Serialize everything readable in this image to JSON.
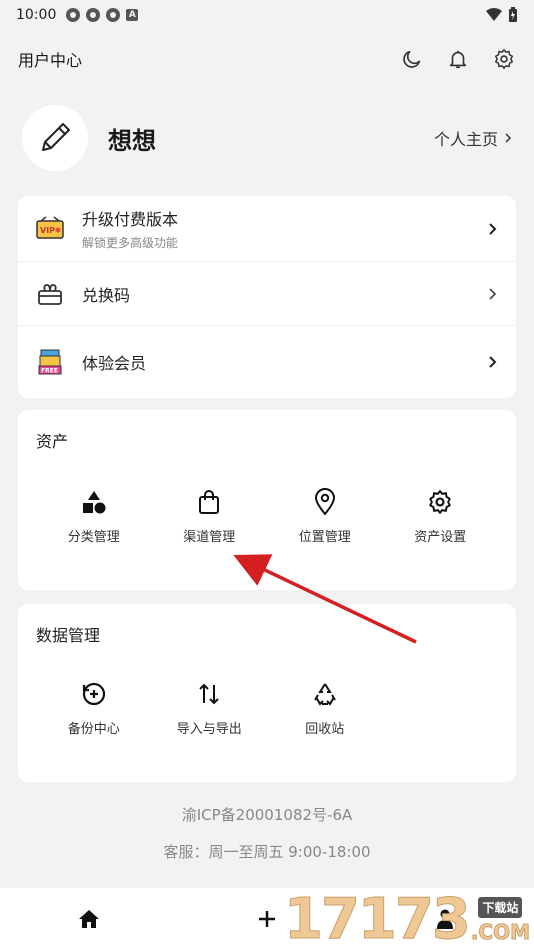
{
  "status_bar": {
    "time": "10:00",
    "a_label": "A"
  },
  "header": {
    "title": "用户中心"
  },
  "profile": {
    "name": "想想",
    "home_link": "个人主页"
  },
  "menu": [
    {
      "label": "升级付费版本",
      "sub": "解锁更多高级功能"
    },
    {
      "label": "兑换码"
    },
    {
      "label": "体验会员"
    }
  ],
  "assets": {
    "title": "资产",
    "items": [
      {
        "label": "分类管理",
        "icon": "shapes-icon"
      },
      {
        "label": "渠道管理",
        "icon": "shopping-bag-icon"
      },
      {
        "label": "位置管理",
        "icon": "location-pin-icon"
      },
      {
        "label": "资产设置",
        "icon": "gear-icon"
      }
    ]
  },
  "data_management": {
    "title": "数据管理",
    "items": [
      {
        "label": "备份中心",
        "icon": "backup-icon"
      },
      {
        "label": "导入与导出",
        "icon": "import-export-icon"
      },
      {
        "label": "回收站",
        "icon": "recycle-icon"
      }
    ]
  },
  "footer": {
    "icp": "渝ICP备20001082号-6A",
    "service": "客服：周一至周五 9:00-18:00"
  },
  "watermark": {
    "number": "17173",
    "tag": "下载站",
    "domain": ".COM"
  },
  "colors": {
    "accent": "#d42020",
    "background": "#f2f2f2",
    "card": "#ffffff",
    "watermark": "#f0c896"
  }
}
